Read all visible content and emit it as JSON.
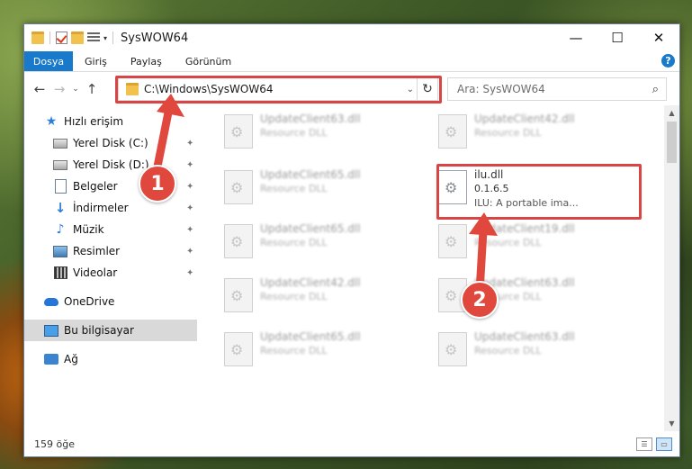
{
  "window": {
    "title": "SysWOW64",
    "controls": [
      "—",
      "☐",
      "✕"
    ]
  },
  "ribbon": {
    "tabs": [
      "Dosya",
      "Giriş",
      "Paylaş",
      "Görünüm"
    ],
    "help": "?"
  },
  "nav": {
    "back": "←",
    "forward": "→",
    "recent": "⌄",
    "up": "↑"
  },
  "address": {
    "path": "C:\\Windows\\SysWOW64",
    "dropdown": "⌄",
    "refresh": "↻"
  },
  "search": {
    "placeholder": "Ara: SysWOW64",
    "icon": "⌕"
  },
  "sidebar": {
    "items": [
      {
        "label": "Hızlı erişim",
        "icon": "star-icon"
      },
      {
        "label": "Yerel Disk (C:)",
        "icon": "drive-icon",
        "pinned": true
      },
      {
        "label": "Yerel Disk (D:)",
        "icon": "drive-icon",
        "pinned": true
      },
      {
        "label": "Belgeler",
        "icon": "documents-icon",
        "pinned": true
      },
      {
        "label": "İndirmeler",
        "icon": "download-icon",
        "pinned": true
      },
      {
        "label": "Müzik",
        "icon": "music-icon",
        "pinned": true
      },
      {
        "label": "Resimler",
        "icon": "pictures-icon",
        "pinned": true
      },
      {
        "label": "Videolar",
        "icon": "videos-icon",
        "pinned": true
      },
      {
        "label": "OneDrive",
        "icon": "cloud-icon"
      },
      {
        "label": "Bu bilgisayar",
        "icon": "computer-icon",
        "selected": true
      },
      {
        "label": "Ağ",
        "icon": "network-icon"
      }
    ],
    "pin_glyph": "✦"
  },
  "files": [
    {
      "name": "UpdateClient63.dll",
      "desc": "Resource DLL"
    },
    {
      "name": "UpdateClient42.dll",
      "desc": "Resource DLL"
    },
    {
      "name": "UpdateClient65.dll",
      "desc": "Resource DLL"
    },
    {
      "name": "ilu.dll",
      "version": "0.1.6.5",
      "desc": "ILU: A portable ima...",
      "highlighted": true
    },
    {
      "name": "UpdateClient65.dll",
      "desc": "Resource DLL"
    },
    {
      "name": "UpdateClient19.dll",
      "desc": "Resource DLL"
    },
    {
      "name": "UpdateClient42.dll",
      "desc": "Resource DLL"
    },
    {
      "name": "UpdateClient63.dll",
      "desc": "Resource DLL"
    },
    {
      "name": "UpdateClient65.dll",
      "desc": "Resource DLL"
    },
    {
      "name": "UpdateClient63.dll",
      "desc": "Resource DLL"
    }
  ],
  "status": {
    "count": "159 öğe"
  },
  "annotations": {
    "step1": "1",
    "step2": "2",
    "color": "#e0473d"
  },
  "scrollbar": {
    "up": "▲",
    "down": "▼"
  }
}
